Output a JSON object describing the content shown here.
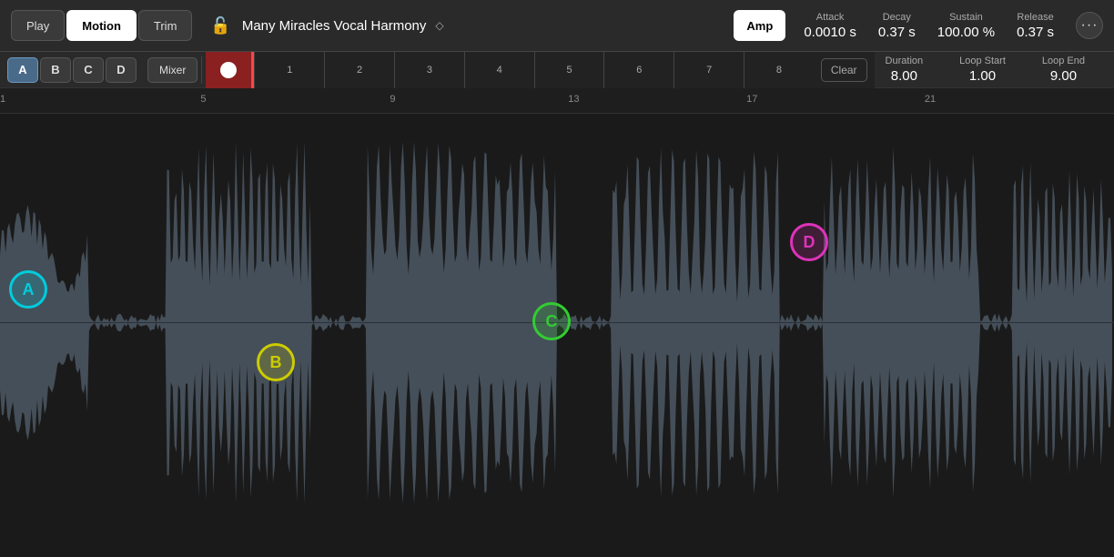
{
  "toolbar": {
    "play_label": "Play",
    "motion_label": "Motion",
    "trim_label": "Trim",
    "track_name": "Many Miracles Vocal Harmony",
    "amp_label": "Amp",
    "attack_label": "Attack",
    "attack_value": "0.0010 s",
    "decay_label": "Decay",
    "decay_value": "0.37 s",
    "sustain_label": "Sustain",
    "sustain_value": "100.00 %",
    "release_label": "Release",
    "release_value": "0.37 s",
    "more_icon": "···"
  },
  "second_row": {
    "pad_a": "A",
    "pad_b": "B",
    "pad_c": "C",
    "pad_d": "D",
    "mixer_label": "Mixer",
    "clear_label": "Clear",
    "duration_label": "Duration",
    "duration_value": "8.00",
    "loop_start_label": "Loop Start",
    "loop_start_value": "1.00",
    "loop_end_label": "Loop End",
    "loop_end_value": "9.00"
  },
  "ruler": {
    "ticks": [
      "1",
      "2",
      "3",
      "4",
      "5",
      "6",
      "7",
      "8"
    ]
  },
  "beat_numbers": {
    "marks": [
      {
        "label": "1",
        "pct": 0
      },
      {
        "label": "5",
        "pct": 18
      },
      {
        "label": "9",
        "pct": 35
      },
      {
        "label": "13",
        "pct": 51
      },
      {
        "label": "17",
        "pct": 67
      },
      {
        "label": "21",
        "pct": 83
      }
    ]
  },
  "cue_markers": [
    {
      "id": "A",
      "class": "cue-a"
    },
    {
      "id": "B",
      "class": "cue-b"
    },
    {
      "id": "C",
      "class": "cue-c"
    },
    {
      "id": "D",
      "class": "cue-d"
    }
  ]
}
